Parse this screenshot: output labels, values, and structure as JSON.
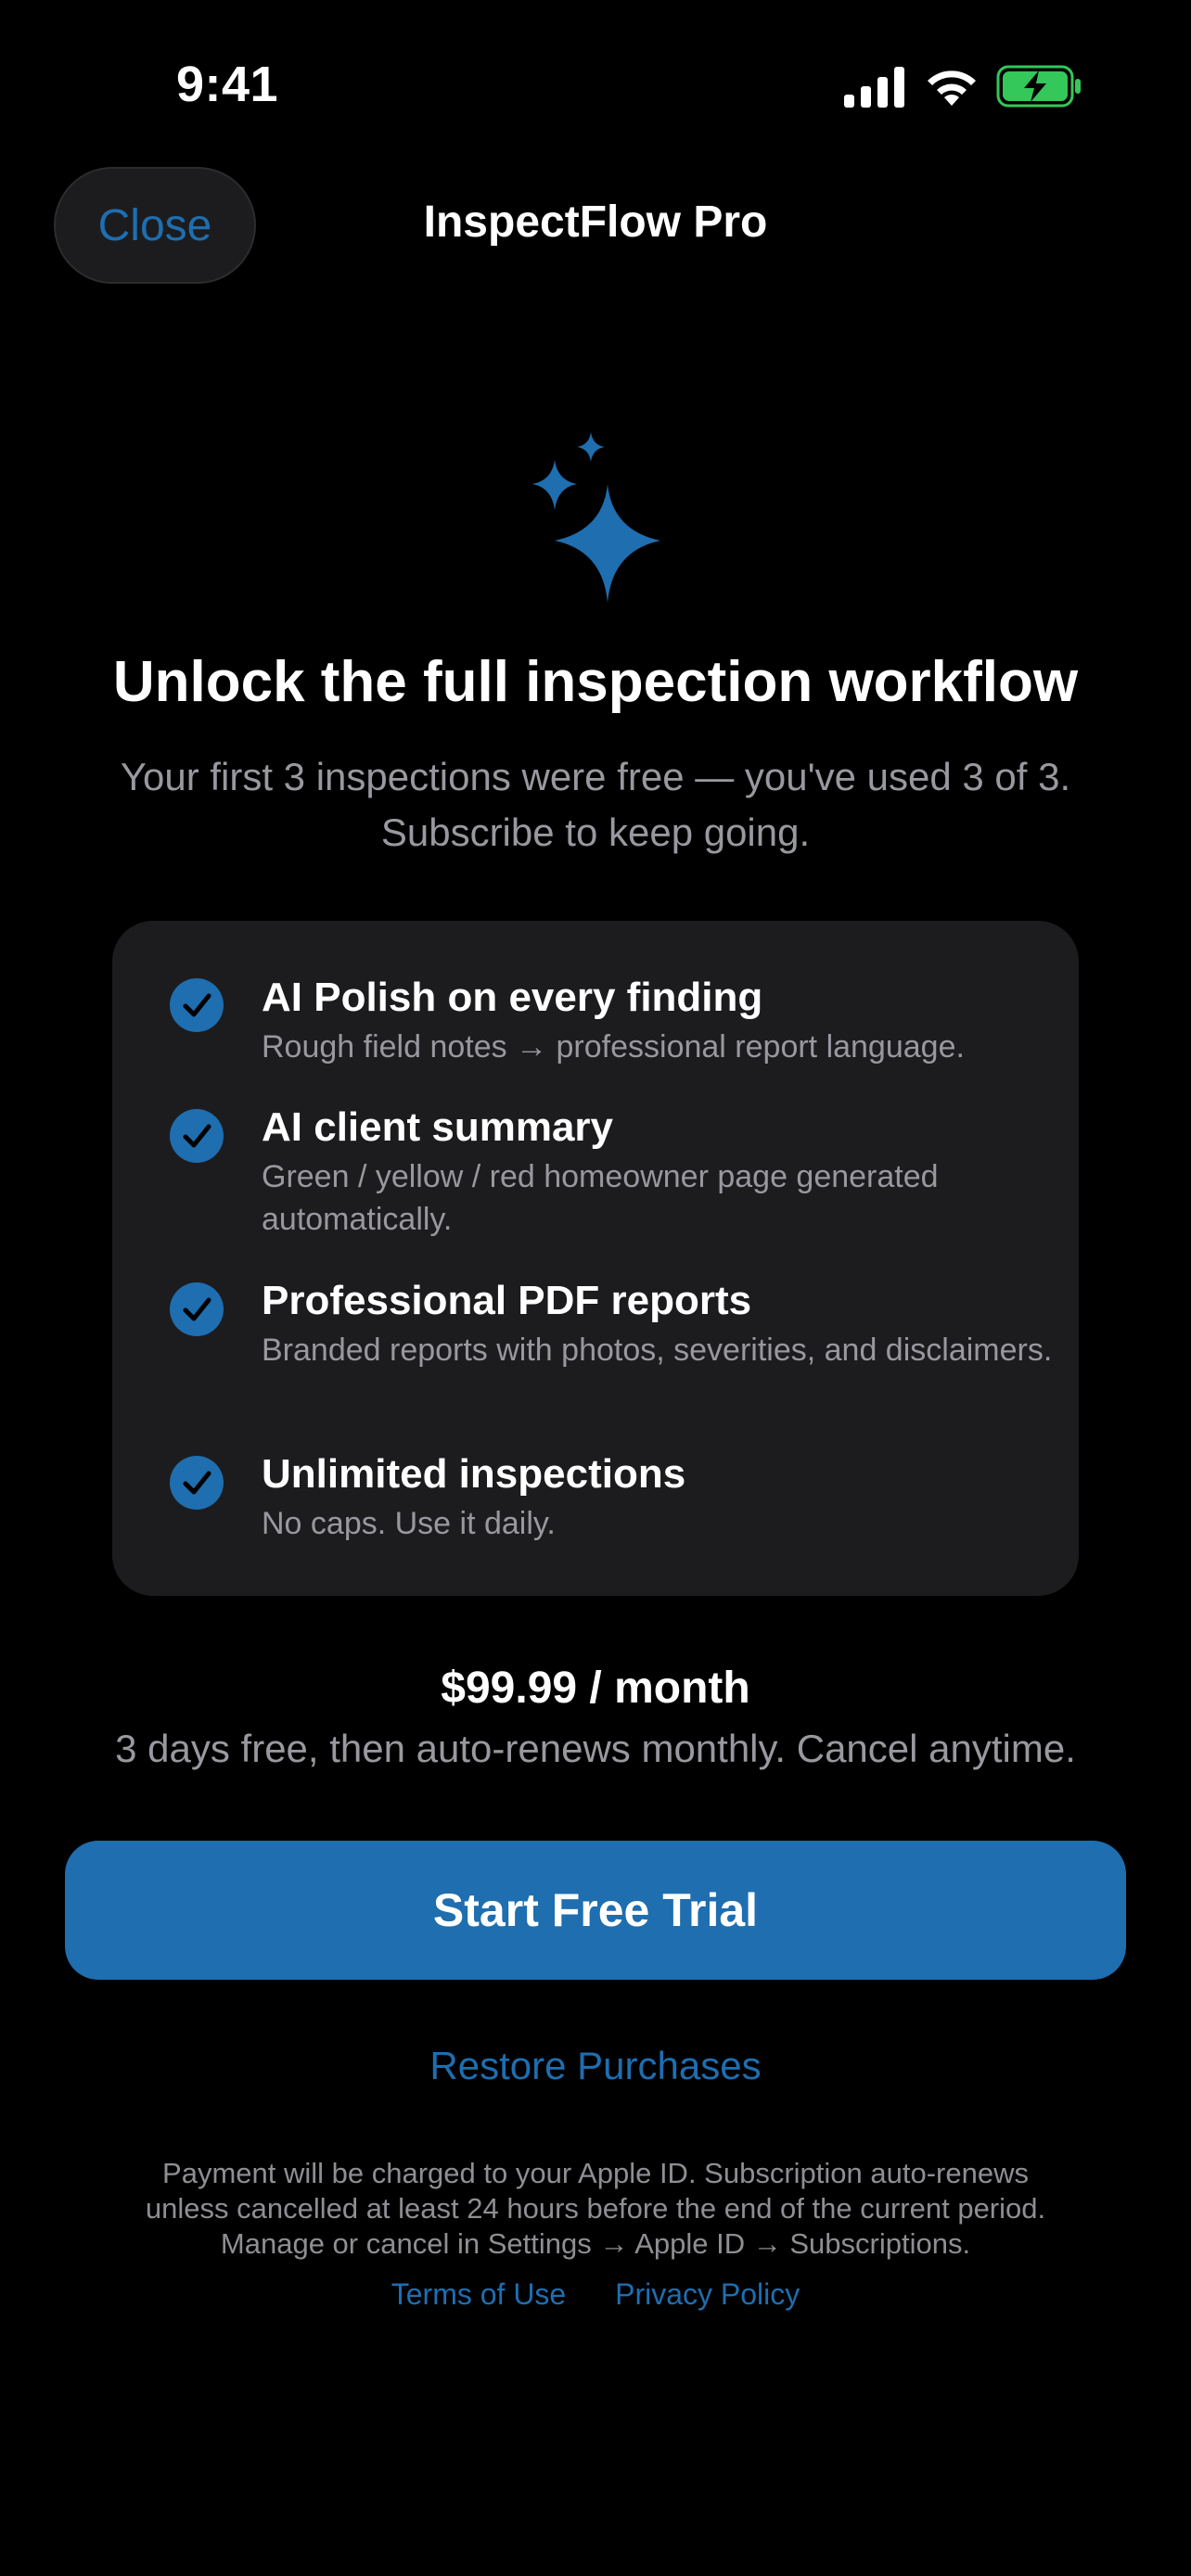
{
  "status_bar": {
    "time": "9:41",
    "icons": [
      "cellular-signal-icon",
      "wifi-icon",
      "battery-charging-icon"
    ]
  },
  "nav": {
    "close_label": "Close",
    "title": "InspectFlow Pro"
  },
  "hero": {
    "icon": "sparkles-icon",
    "headline": "Unlock the full inspection workflow",
    "subheadline_line1": "Your first 3 inspections were free — you've used 3 of 3.",
    "subheadline_line2": "Subscribe to keep going."
  },
  "features": [
    {
      "title": "AI Polish on every finding",
      "description": "Rough field notes → professional report language."
    },
    {
      "title": "AI client summary",
      "description": "Green / yellow / red homeowner page generated automatically."
    },
    {
      "title": "Professional PDF reports",
      "description": "Branded reports with photos, severities, and disclaimers."
    },
    {
      "title": "Unlimited inspections",
      "description": "No caps. Use it daily."
    }
  ],
  "pricing": {
    "price": "$99.99 / month",
    "note": "3 days free, then auto-renews monthly. Cancel anytime."
  },
  "actions": {
    "cta_label": "Start Free Trial",
    "restore_label": "Restore Purchases"
  },
  "legal": {
    "line1": "Payment will be charged to your Apple ID. Subscription auto-renews",
    "line2": "unless cancelled at least 24 hours before the end of the current period.",
    "line3": "Manage or cancel in Settings → Apple ID → Subscriptions.",
    "terms_label": "Terms of Use",
    "privacy_label": "Privacy Policy"
  },
  "colors": {
    "background": "#000000",
    "accent": "#1e6eb0",
    "card": "#1c1c1e",
    "secondary_text": "#98989f",
    "battery_green": "#34c759"
  }
}
